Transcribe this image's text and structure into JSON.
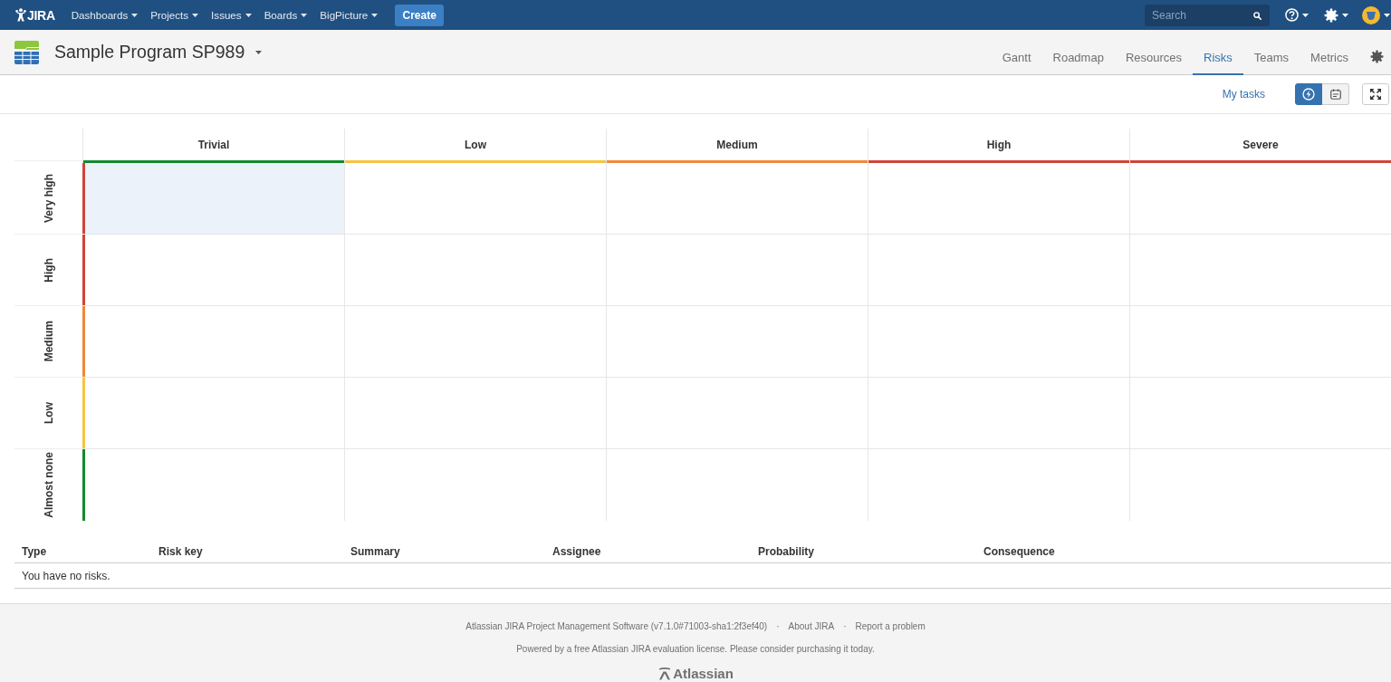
{
  "top_nav": {
    "logo_text": "JIRA",
    "menus": [
      "Dashboards",
      "Projects",
      "Issues",
      "Boards",
      "BigPicture"
    ],
    "create_button": "Create",
    "search": {
      "placeholder": "Search"
    }
  },
  "program_header": {
    "title": "Sample Program SP989",
    "tabs": [
      {
        "label": "Gantt",
        "selected": false
      },
      {
        "label": "Roadmap",
        "selected": false
      },
      {
        "label": "Resources",
        "selected": false
      },
      {
        "label": "Risks",
        "selected": true
      },
      {
        "label": "Teams",
        "selected": false
      },
      {
        "label": "Metrics",
        "selected": false
      }
    ]
  },
  "toolbar": {
    "my_tasks_link": "My tasks",
    "view_toggles": [
      {
        "selected": true
      },
      {
        "selected": false
      }
    ]
  },
  "risk_matrix": {
    "columns": [
      {
        "label": "Trivial",
        "color": "#14892c"
      },
      {
        "label": "Low",
        "color": "#f6c342"
      },
      {
        "label": "Medium",
        "color": "#f0883a"
      },
      {
        "label": "High",
        "color": "#d04437"
      },
      {
        "label": "Severe",
        "color": "#d04437"
      }
    ],
    "rows": [
      {
        "label": "Very high",
        "color": "#d04437",
        "cells": [
          {
            "selected": true
          },
          {
            "selected": false
          },
          {
            "selected": false
          },
          {
            "selected": false
          },
          {
            "selected": false
          }
        ]
      },
      {
        "label": "High",
        "color": "#d04437",
        "cells": [
          {
            "selected": false
          },
          {
            "selected": false
          },
          {
            "selected": false
          },
          {
            "selected": false
          },
          {
            "selected": false
          }
        ]
      },
      {
        "label": "Medium",
        "color": "#f0883a",
        "cells": [
          {
            "selected": false
          },
          {
            "selected": false
          },
          {
            "selected": false
          },
          {
            "selected": false
          },
          {
            "selected": false
          }
        ]
      },
      {
        "label": "Low",
        "color": "#f6c342",
        "cells": [
          {
            "selected": false
          },
          {
            "selected": false
          },
          {
            "selected": false
          },
          {
            "selected": false
          },
          {
            "selected": false
          }
        ]
      },
      {
        "label": "Almost none",
        "color": "#14892c",
        "cells": [
          {
            "selected": false
          },
          {
            "selected": false
          },
          {
            "selected": false
          },
          {
            "selected": false
          },
          {
            "selected": false
          }
        ]
      }
    ]
  },
  "risks_table": {
    "columns": [
      "Type",
      "Risk key",
      "Summary",
      "Assignee",
      "Probability",
      "Consequence"
    ],
    "empty_message": "You have no risks."
  },
  "footer": {
    "line_1": {
      "version_text": "Atlassian JIRA Project Management Software (v7.1.0#71003-sha1:2f3ef40)",
      "links": [
        {
          "separator": "·",
          "label": "About JIRA"
        },
        {
          "separator": "·",
          "label": "Report a problem"
        }
      ]
    },
    "line_2": "Powered by a free Atlassian JIRA evaluation license. Please consider purchasing it today.",
    "logo_text": "Atlassian"
  }
}
